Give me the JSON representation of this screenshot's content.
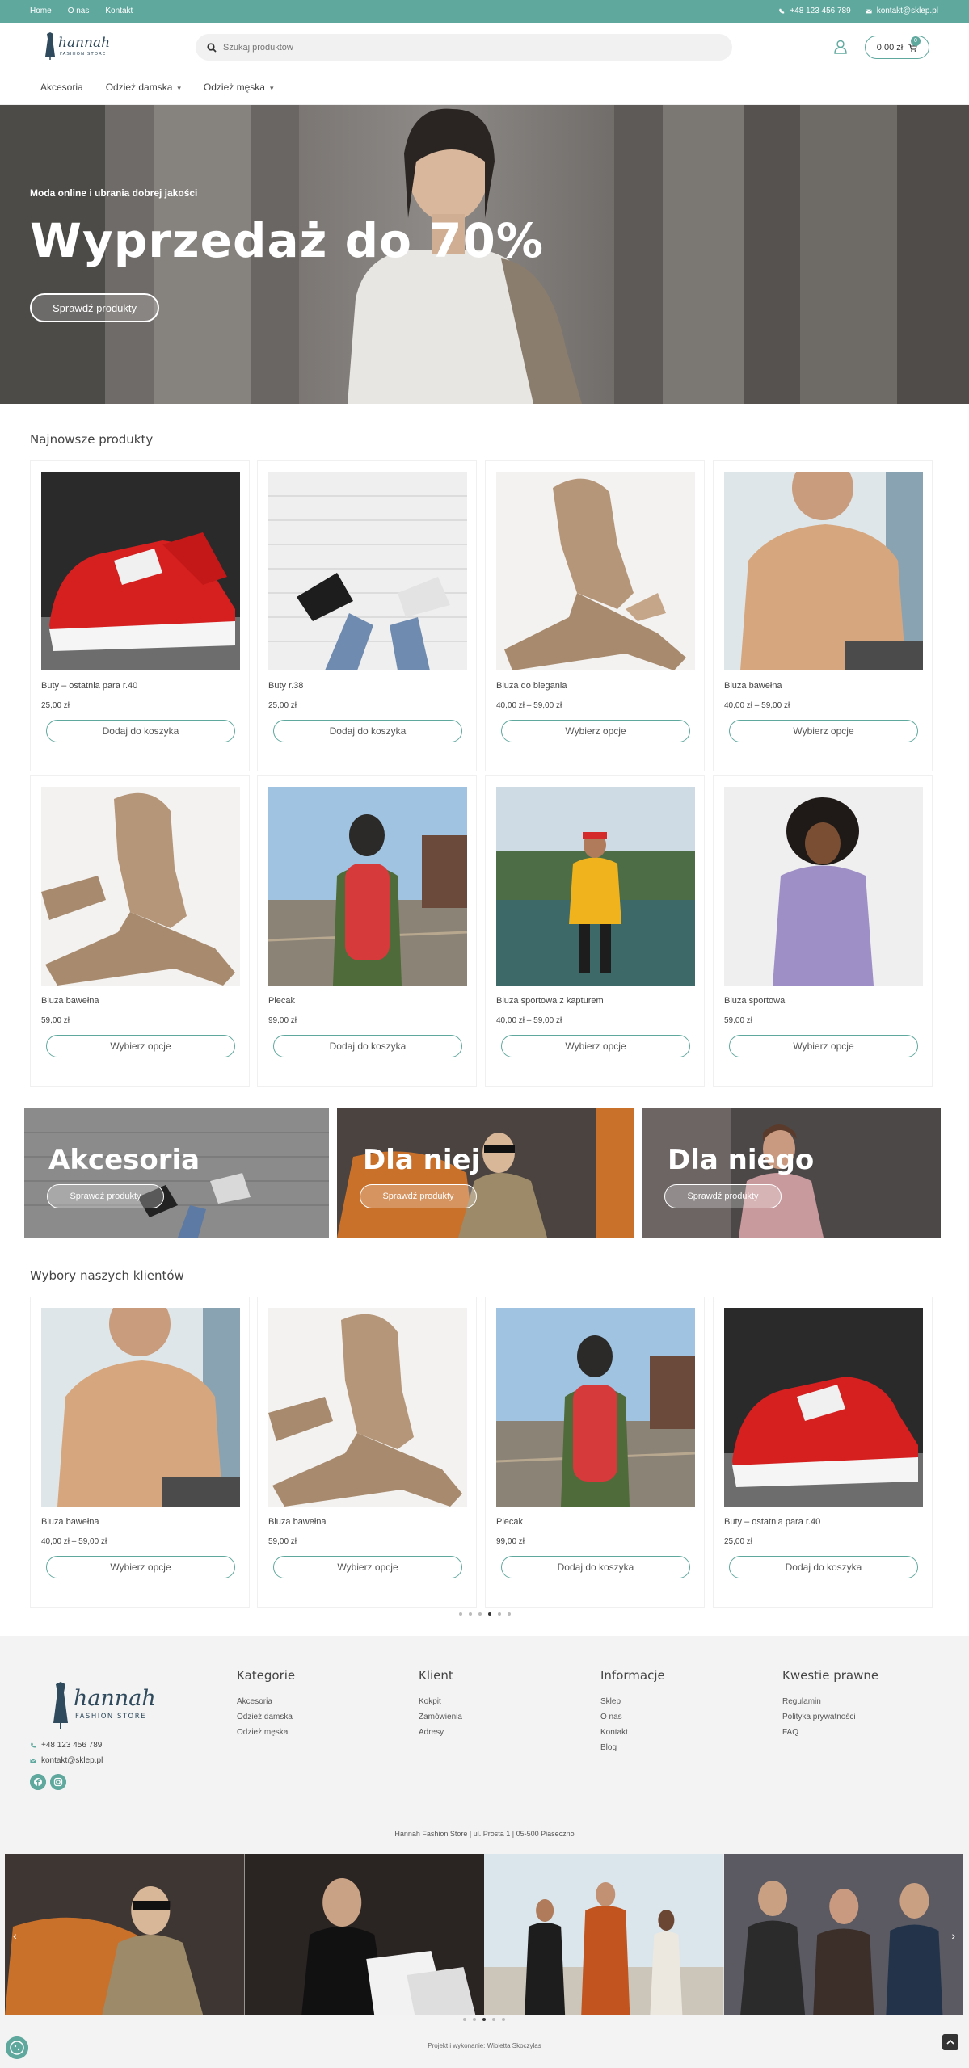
{
  "topbar": {
    "links": [
      "Home",
      "O nas",
      "Kontakt"
    ],
    "phone": "+48 123 456 789",
    "email": "kontakt@sklep.pl"
  },
  "header": {
    "logo_text": "hannah",
    "logo_subtext": "FASHION STORE",
    "search_placeholder": "Szukaj produktów",
    "cart_total": "0,00 zł",
    "cart_count": "0"
  },
  "nav": {
    "items": [
      "Akcesoria",
      "Odzież damska",
      "Odzież męska"
    ]
  },
  "hero": {
    "tagline": "Moda online i ubrania dobrej jakości",
    "title": "Wyprzedaż do 70%",
    "cta": "Sprawdź produkty"
  },
  "newest": {
    "title": "Najnowsze produkty",
    "products": [
      {
        "name": "Buty – ostatnia para r.40",
        "price": "25,00 zł",
        "button": "Dodaj do koszyka"
      },
      {
        "name": "Buty r.38",
        "price": "25,00 zł",
        "button": "Dodaj do koszyka"
      },
      {
        "name": "Bluza do biegania",
        "price": "40,00 zł – 59,00 zł",
        "button": "Wybierz opcje"
      },
      {
        "name": "Bluza bawełna",
        "price": "40,00 zł – 59,00 zł",
        "button": "Wybierz opcje"
      },
      {
        "name": "Bluza bawełna",
        "price": "59,00 zł",
        "button": "Wybierz opcje"
      },
      {
        "name": "Plecak",
        "price": "99,00 zł",
        "button": "Dodaj do koszyka"
      },
      {
        "name": "Bluza sportowa z kapturem",
        "price": "40,00 zł – 59,00 zł",
        "button": "Wybierz opcje"
      },
      {
        "name": "Bluza sportowa",
        "price": "59,00 zł",
        "button": "Wybierz opcje"
      }
    ]
  },
  "categories": [
    {
      "label": "Akcesoria",
      "button": "Sprawdź produkty"
    },
    {
      "label": "Dla niej",
      "button": "Sprawdź produkty"
    },
    {
      "label": "Dla niego",
      "button": "Sprawdź produkty"
    }
  ],
  "picks": {
    "title": "Wybory naszych klientów",
    "products": [
      {
        "name": "Bluza bawełna",
        "price": "40,00 zł – 59,00 zł",
        "button": "Wybierz opcje"
      },
      {
        "name": "Bluza bawełna",
        "price": "59,00 zł",
        "button": "Wybierz opcje"
      },
      {
        "name": "Plecak",
        "price": "99,00 zł",
        "button": "Dodaj do koszyka"
      },
      {
        "name": "Buty – ostatnia para r.40",
        "price": "25,00 zł",
        "button": "Dodaj do koszyka"
      }
    ],
    "active_dot": 3
  },
  "footer": {
    "phone": "+48 123 456 789",
    "email": "kontakt@sklep.pl",
    "columns": [
      {
        "title": "Kategorie",
        "links": [
          "Akcesoria",
          "Odzież damska",
          "Odzież męska"
        ]
      },
      {
        "title": "Klient",
        "links": [
          "Kokpit",
          "Zamówienia",
          "Adresy"
        ]
      },
      {
        "title": "Informacje",
        "links": [
          "Sklep",
          "O nas",
          "Kontakt",
          "Blog"
        ]
      },
      {
        "title": "Kwestie prawne",
        "links": [
          "Regulamin",
          "Polityka prywatności",
          "FAQ"
        ]
      }
    ],
    "address": "Hannah Fashion Store  |  ul. Prosta 1  |  05-500 Piaseczno",
    "credit": "Projekt i wykonanie: Wioletta Skoczylas"
  },
  "colors": {
    "accent": "#5fa89e",
    "topbar": "#5fa89e",
    "footer_bg": "#f3f3f3"
  },
  "icons": [
    "phone-icon",
    "mail-icon",
    "search-icon",
    "user-icon",
    "cart-icon",
    "chevron-down-icon",
    "facebook-icon",
    "instagram-icon",
    "arrow-up-icon",
    "cookie-icon"
  ]
}
